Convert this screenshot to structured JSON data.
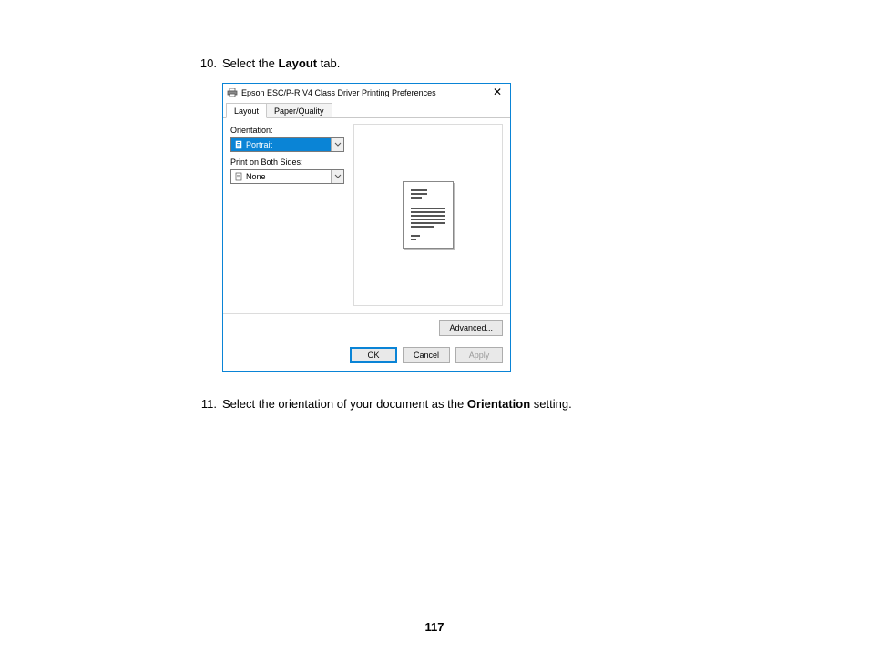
{
  "steps": {
    "s10": {
      "num": "10.",
      "pre": "Select the ",
      "bold": "Layout",
      "post": " tab."
    },
    "s11": {
      "num": "11.",
      "pre": "Select the orientation of your document as the ",
      "bold": "Orientation",
      "post": " setting."
    }
  },
  "dialog": {
    "title": "Epson ESC/P-R V4 Class Driver Printing Preferences",
    "close_glyph": "✕",
    "tabs": {
      "layout": "Layout",
      "paper": "Paper/Quality"
    },
    "orientation_label": "Orientation:",
    "orientation_value": "Portrait",
    "bothsides_label": "Print on Both Sides:",
    "bothsides_value": "None",
    "advanced": "Advanced...",
    "ok": "OK",
    "cancel": "Cancel",
    "apply": "Apply"
  },
  "page_number": "117"
}
